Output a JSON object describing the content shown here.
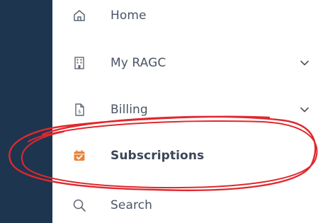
{
  "menu": {
    "items": [
      {
        "label": "Home",
        "icon": "home-icon",
        "expandable": false
      },
      {
        "label": "My RAGC",
        "icon": "building-icon",
        "expandable": true
      },
      {
        "label": "Billing",
        "icon": "invoice-icon",
        "expandable": true
      },
      {
        "label": "Subscriptions",
        "icon": "calendar-check-icon",
        "expandable": false,
        "active": true
      },
      {
        "label": "Search",
        "icon": "search-icon",
        "expandable": false
      }
    ]
  },
  "colors": {
    "sidebar_dark": "#1e3550",
    "menu_background": "#ffffff",
    "label_text": "#4a5566",
    "icon_stroke": "#5d6775",
    "active_icon": "#e8843c",
    "annotation_red": "#e0282e"
  }
}
